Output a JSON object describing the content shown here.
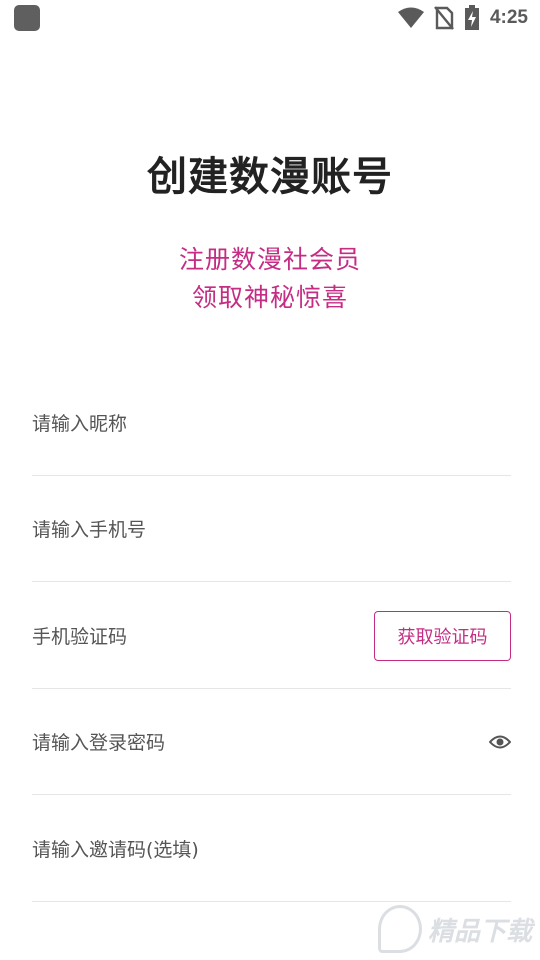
{
  "status_bar": {
    "time": "4:25",
    "icons": [
      "app-icon",
      "wifi-icon",
      "no-sim-icon",
      "battery-charging-icon"
    ]
  },
  "header": {
    "title": "创建数漫账号",
    "subtitle_line1": "注册数漫社会员",
    "subtitle_line2": "领取神秘惊喜"
  },
  "form": {
    "nickname_placeholder": "请输入昵称",
    "phone_placeholder": "请输入手机号",
    "code_placeholder": "手机验证码",
    "get_code_label": "获取验证码",
    "password_placeholder": "请输入登录密码",
    "invite_placeholder": "请输入邀请码(选填)"
  },
  "watermark": {
    "text": "精品下载"
  },
  "colors": {
    "accent": "#c52d85",
    "title": "#222222",
    "placeholder": "#555555"
  }
}
